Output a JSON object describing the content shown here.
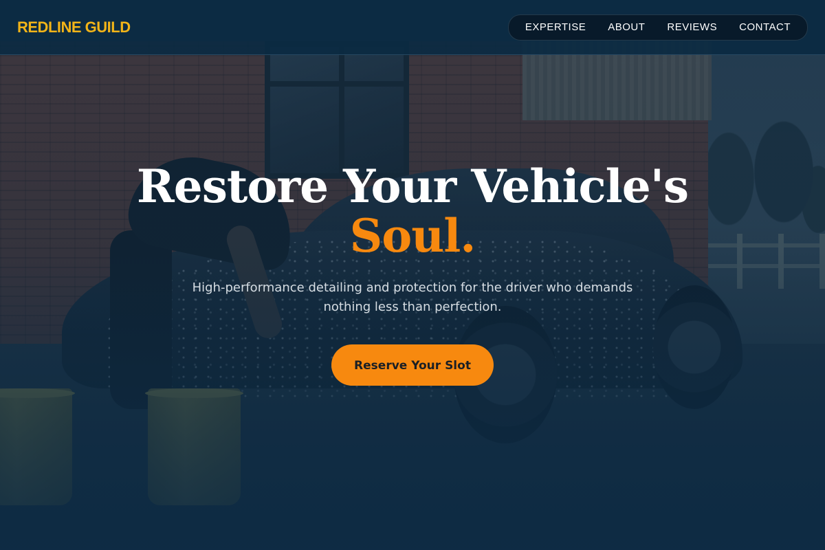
{
  "brand": {
    "name": "REDLINE GUILD",
    "color": "#f2b418"
  },
  "nav": {
    "items": [
      {
        "label": "EXPERTISE"
      },
      {
        "label": "ABOUT"
      },
      {
        "label": "REVIEWS"
      },
      {
        "label": "CONTACT"
      }
    ]
  },
  "hero": {
    "headline_line1": "Restore Your Vehicle's",
    "headline_line2": "Soul.",
    "subtitle": "High-performance detailing and protection for the driver who demands nothing less than perfection.",
    "cta_label": "Reserve Your Slot",
    "accent_color": "#f7890f"
  },
  "background": {
    "description_icons": [
      "car-image",
      "wash-bucket-icon"
    ]
  }
}
